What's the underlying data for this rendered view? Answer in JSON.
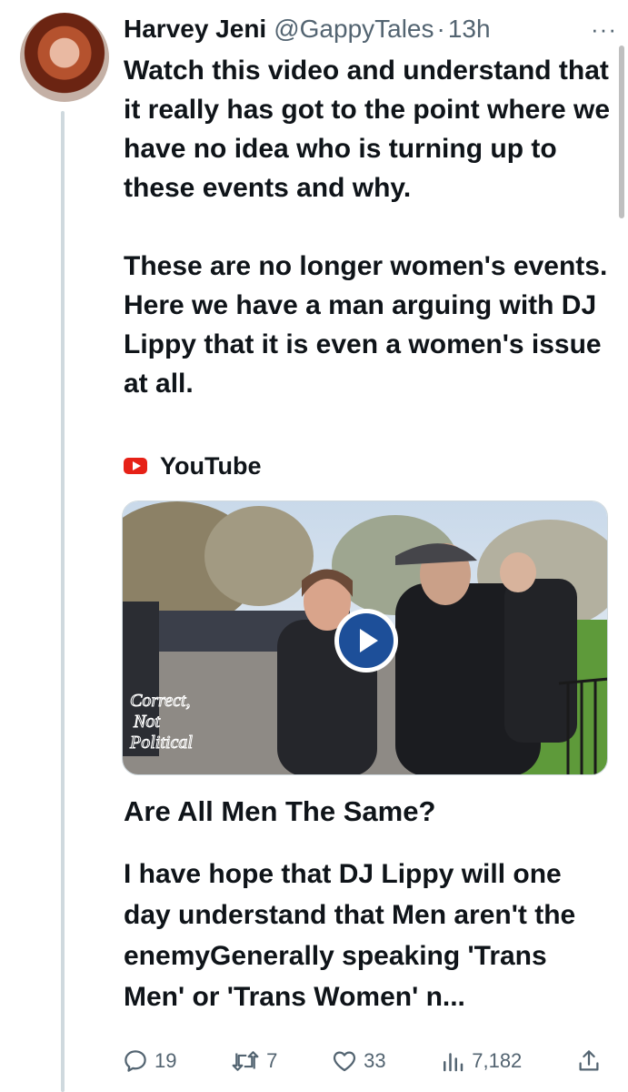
{
  "tweet": {
    "author_name": "Harvey Jeni",
    "handle": "@GappyTales",
    "separator": "·",
    "time": "13h",
    "more_label": "···",
    "paragraphs": [
      "Watch this video and understand that it really has got to the point where we have no idea who is turning up to these events and why.",
      "These are no longer women's events. Here we have a man arguing with DJ Lippy that it is even a women's issue at all."
    ]
  },
  "card": {
    "source": "YouTube",
    "watermark": [
      "Correct,",
      "Not",
      "Political"
    ],
    "title": "Are All Men The Same?",
    "description": "I have hope that DJ Lippy will one day understand that Men aren't the enemyGenerally speaking 'Trans Men' or 'Trans Women' n..."
  },
  "actions": {
    "replies": "19",
    "reposts": "7",
    "likes": "33",
    "views": "7,182"
  },
  "icons": {
    "reply": "reply-icon",
    "repost": "repost-icon",
    "like": "heart-icon",
    "views": "views-icon",
    "share": "share-icon",
    "play": "play-icon",
    "youtube": "youtube-icon"
  },
  "colors": {
    "text": "#0f1419",
    "secondary": "#536471",
    "thread_line": "#cfd9de",
    "youtube_red": "#e62117",
    "play_blue": "#1d4f99"
  }
}
